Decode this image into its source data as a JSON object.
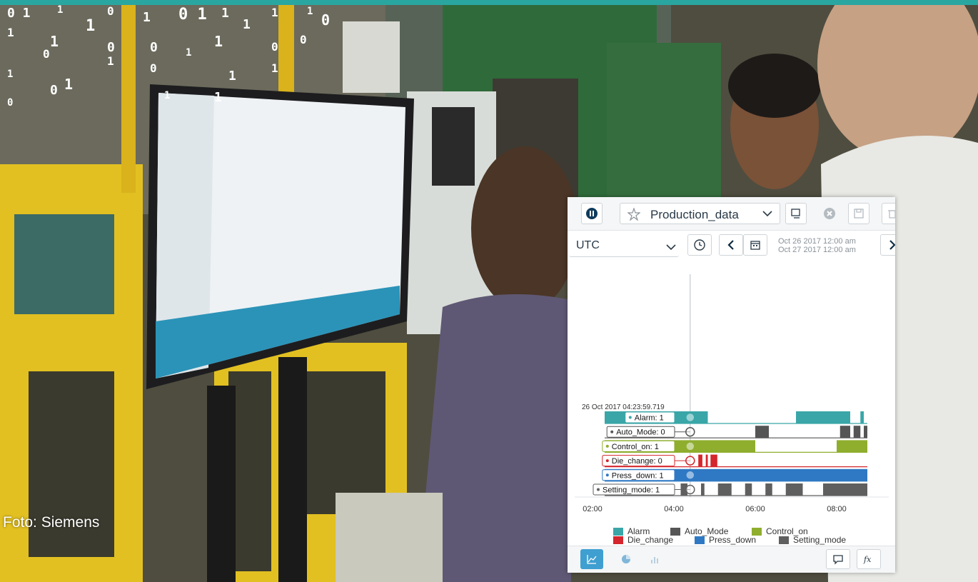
{
  "photo": {
    "credit": "Foto: Siemens"
  },
  "binary_overlay": [
    "0 1",
    "1",
    "0",
    "1",
    "0 1",
    "1",
    "1",
    "1",
    "1",
    "1",
    "0",
    "0",
    "1",
    "0",
    "1",
    "0",
    "0",
    "1",
    "1",
    "0",
    "1",
    "1",
    "1",
    "1",
    "0",
    "0",
    "1",
    "1",
    "1",
    "0"
  ],
  "panel": {
    "asset_name": "Production_data",
    "timezone": "UTC",
    "range_start": "Oct 26 2017 12:00 am",
    "range_end": "Oct 27 2017 12:00 am",
    "cursor_timestamp": "26 Oct 2017 04:23:59.719"
  },
  "colors": {
    "accent": "#2aa6a0",
    "Alarm": "#3aa6a8",
    "Auto_Mode": "#555555",
    "Control_on": "#8fae2e",
    "Die_change": "#d4262c",
    "Press_down": "#2f79c4",
    "Setting_mode": "#5f5f5f"
  },
  "icons": [
    "app-logo-icon",
    "star-icon",
    "chevron-down-icon",
    "export-icon",
    "close-circle-icon",
    "save-icon",
    "delete-icon",
    "clock-icon",
    "chevron-left-icon",
    "calendar-icon",
    "chevron-right-icon",
    "line-chart-icon",
    "pie-chart-icon",
    "bar-chart-icon",
    "comment-icon",
    "fx-icon"
  ],
  "chart_data": {
    "type": "timeline",
    "xlabel": "",
    "ylabel": "",
    "x_ticks": [
      "02:00",
      "04:00",
      "06:00",
      "08:00"
    ],
    "cursor_time": "04:24",
    "series": [
      {
        "name": "Alarm",
        "value_label": "Alarm: 1",
        "intervals": [
          [
            "01:40",
            "04:50"
          ],
          [
            "07:00",
            "08:20"
          ],
          [
            "08:35",
            "08:40"
          ]
        ]
      },
      {
        "name": "Auto_Mode",
        "value_label": "Auto_Mode: 0",
        "intervals": [
          [
            "06:00",
            "06:20"
          ],
          [
            "08:05",
            "08:20"
          ],
          [
            "08:25",
            "08:35"
          ],
          [
            "08:40",
            "08:50"
          ]
        ]
      },
      {
        "name": "Control_on",
        "value_label": "Control_on: 1",
        "intervals": [
          [
            "01:40",
            "06:00"
          ],
          [
            "08:00",
            "10:00"
          ]
        ]
      },
      {
        "name": "Die_change",
        "value_label": "Die_change: 0",
        "intervals": [
          [
            "04:36",
            "04:42"
          ],
          [
            "04:47",
            "04:50"
          ],
          [
            "04:54",
            "05:04"
          ]
        ]
      },
      {
        "name": "Press_down",
        "value_label": "Press_down: 1",
        "intervals": [
          [
            "01:40",
            "10:00"
          ]
        ]
      },
      {
        "name": "Setting_mode",
        "value_label": "Setting_mode: 1",
        "intervals": [
          [
            "04:10",
            "04:20"
          ],
          [
            "04:40",
            "04:45"
          ],
          [
            "05:05",
            "05:25"
          ],
          [
            "05:45",
            "05:55"
          ],
          [
            "06:15",
            "06:25"
          ],
          [
            "06:45",
            "07:10"
          ],
          [
            "07:40",
            "08:50"
          ],
          [
            "08:55",
            "09:10"
          ],
          [
            "09:15",
            "09:30"
          ],
          [
            "09:35",
            "10:00"
          ]
        ]
      }
    ]
  },
  "legend": [
    "Alarm",
    "Auto_Mode",
    "Control_on",
    "Die_change",
    "Press_down",
    "Setting_mode"
  ]
}
